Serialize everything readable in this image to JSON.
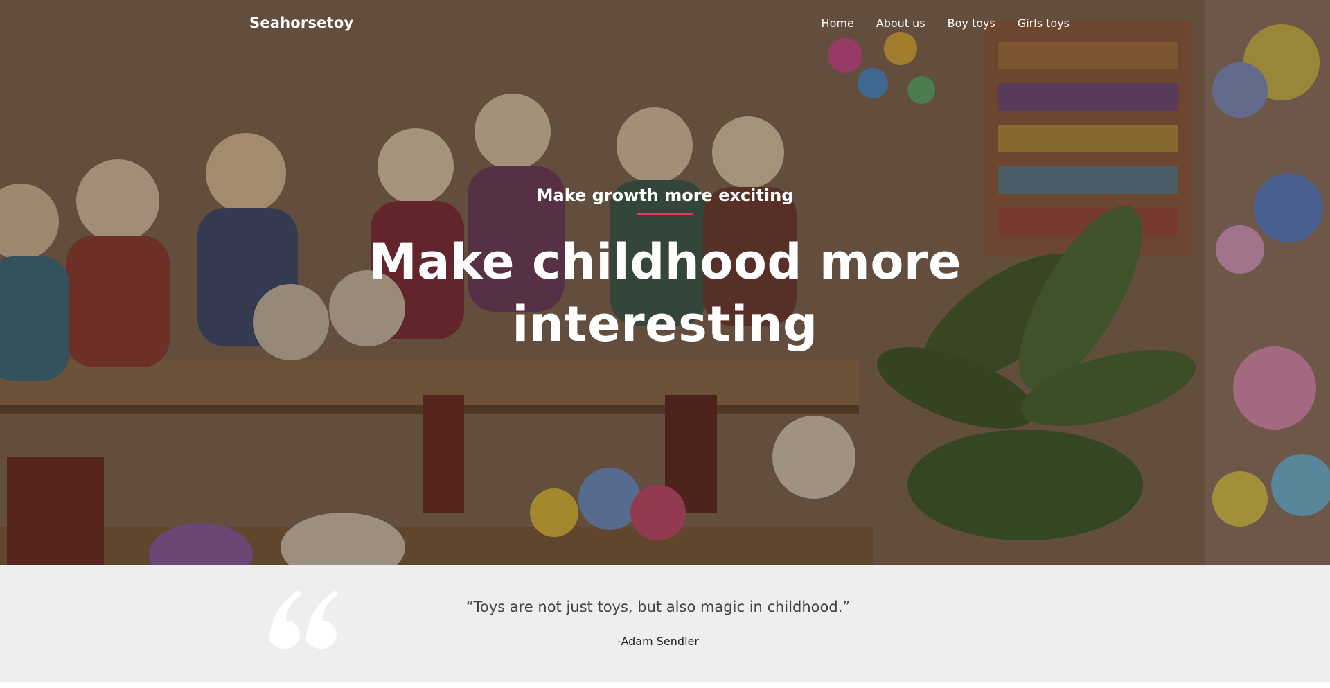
{
  "brand": {
    "name": "Seahorsetoy"
  },
  "nav": {
    "items": [
      {
        "label": "Home"
      },
      {
        "label": "About us"
      },
      {
        "label": "Boy toys"
      },
      {
        "label": "Girls toys"
      }
    ]
  },
  "hero": {
    "subheading": "Make growth more exciting",
    "headline": "Make childhood more interesting",
    "accent_color": "#e8345a"
  },
  "testimonial": {
    "quote": "“Toys are not just toys, but also magic in childhood.”",
    "author": "-Adam Sendler",
    "quote_icon": "quotation-mark-icon"
  }
}
